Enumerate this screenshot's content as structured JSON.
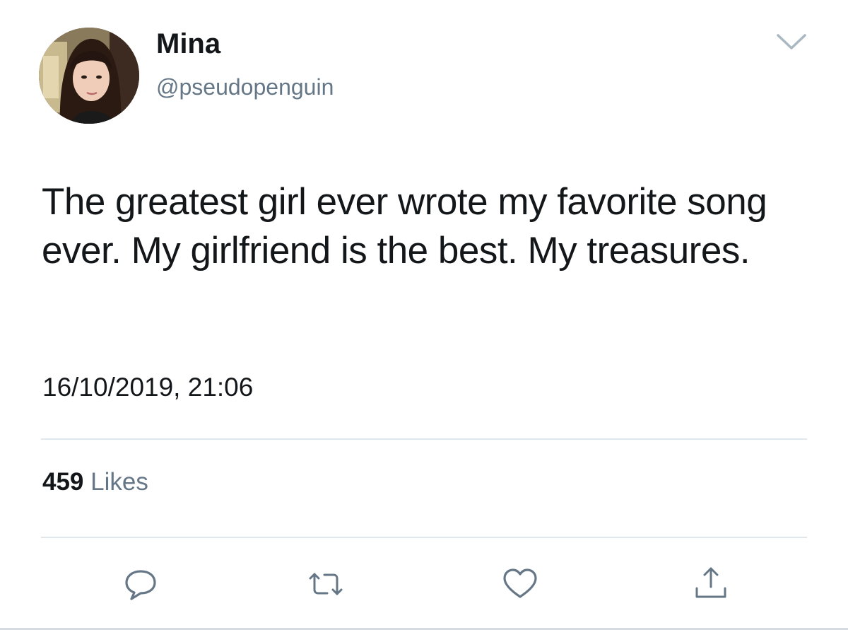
{
  "author": {
    "display_name": "Mina",
    "handle": "@pseudopenguin",
    "avatar_icon": "profile-photo"
  },
  "tweet": {
    "text": "The greatest girl ever wrote my favorite song ever. My girlfriend is the best. My treasures.",
    "timestamp": "16/10/2019, 21:06"
  },
  "stats": {
    "likes_count": "459",
    "likes_label": "Likes"
  },
  "actions": {
    "reply_icon": "reply-icon",
    "retweet_icon": "retweet-icon",
    "like_icon": "heart-icon",
    "share_icon": "share-icon"
  },
  "colors": {
    "text_primary": "#14171a",
    "text_secondary": "#657786",
    "divider": "#e1e8ed",
    "icon": "#657786"
  }
}
